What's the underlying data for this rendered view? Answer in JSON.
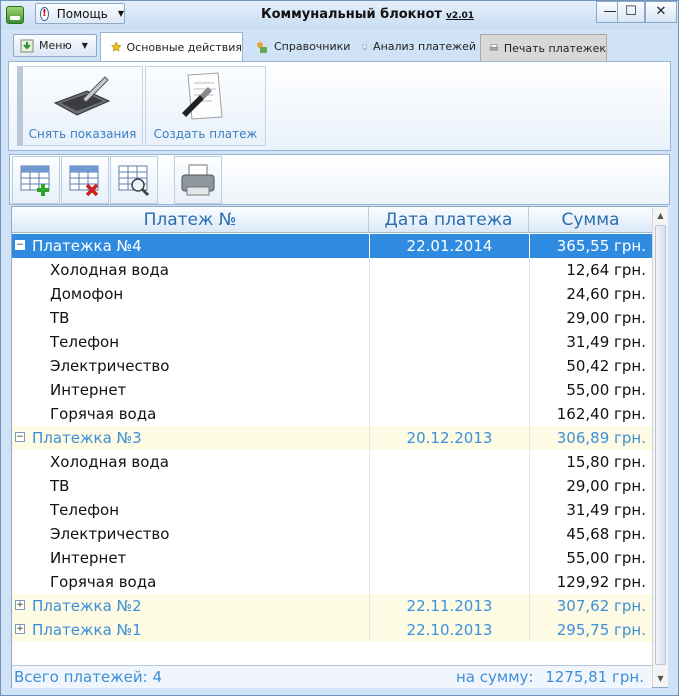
{
  "window": {
    "title": "Коммунальный блокнот",
    "version": "v2.01",
    "help_label": "Помощь",
    "help_icon": "exclamation-icon",
    "minimize_glyph": "—",
    "maximize_glyph": "☐",
    "close_glyph": "✕"
  },
  "tabs": {
    "menu_label": "Меню",
    "items": [
      {
        "label": "Основные действия",
        "icon": "star-icon",
        "active": true
      },
      {
        "label": "Справочники",
        "icon": "book-icon"
      },
      {
        "label": "Анализ платежей",
        "icon": "chart-icon"
      },
      {
        "label": "Печать платежек",
        "icon": "printer-icon"
      }
    ]
  },
  "ribbon": {
    "readings_label": "Снять показания",
    "create_label": "Создать платеж"
  },
  "toolbar": {
    "buttons": [
      "add-row-icon",
      "delete-row-icon",
      "search-table-icon",
      "printer-icon"
    ]
  },
  "grid": {
    "headers": {
      "payment": "Платеж №",
      "date": "Дата платежа",
      "sum": "Сумма"
    },
    "rows": [
      {
        "type": "group",
        "expanded": true,
        "selected": true,
        "name": "Платежка №4",
        "date": "22.01.2014",
        "sum": "365,55 грн."
      },
      {
        "type": "child",
        "name": "Холодная вода",
        "sum": "12,64 грн."
      },
      {
        "type": "child",
        "name": "Домофон",
        "sum": "24,60 грн."
      },
      {
        "type": "child",
        "name": "ТВ",
        "sum": "29,00 грн."
      },
      {
        "type": "child",
        "name": "Телефон",
        "sum": "31,49 грн."
      },
      {
        "type": "child",
        "name": "Электричество",
        "sum": "50,42 грн."
      },
      {
        "type": "child",
        "name": "Интернет",
        "sum": "55,00 грн."
      },
      {
        "type": "child",
        "name": "Горячая вода",
        "sum": "162,40 грн."
      },
      {
        "type": "group",
        "expanded": true,
        "name": "Платежка №3",
        "date": "20.12.2013",
        "sum": "306,89 грн."
      },
      {
        "type": "child",
        "name": "Холодная вода",
        "sum": "15,80 грн."
      },
      {
        "type": "child",
        "name": "ТВ",
        "sum": "29,00 грн."
      },
      {
        "type": "child",
        "name": "Телефон",
        "sum": "31,49 грн."
      },
      {
        "type": "child",
        "name": "Электричество",
        "sum": "45,68 грн."
      },
      {
        "type": "child",
        "name": "Интернет",
        "sum": "55,00 грн."
      },
      {
        "type": "child",
        "name": "Горячая вода",
        "sum": "129,92 грн."
      },
      {
        "type": "group",
        "expanded": false,
        "name": "Платежка №2",
        "date": "22.11.2013",
        "sum": "307,62 грн."
      },
      {
        "type": "group",
        "expanded": false,
        "name": "Платежка №1",
        "date": "22.10.2013",
        "sum": "295,75 грн."
      }
    ],
    "footer": {
      "count_label": "Всего платежей: 4",
      "sum_label": "на сумму:",
      "sum_value": "1275,81 грн."
    }
  },
  "colors": {
    "accent": "#2f8be0",
    "group_text": "#3d8fd8",
    "group_bg": "#fefbe4"
  }
}
